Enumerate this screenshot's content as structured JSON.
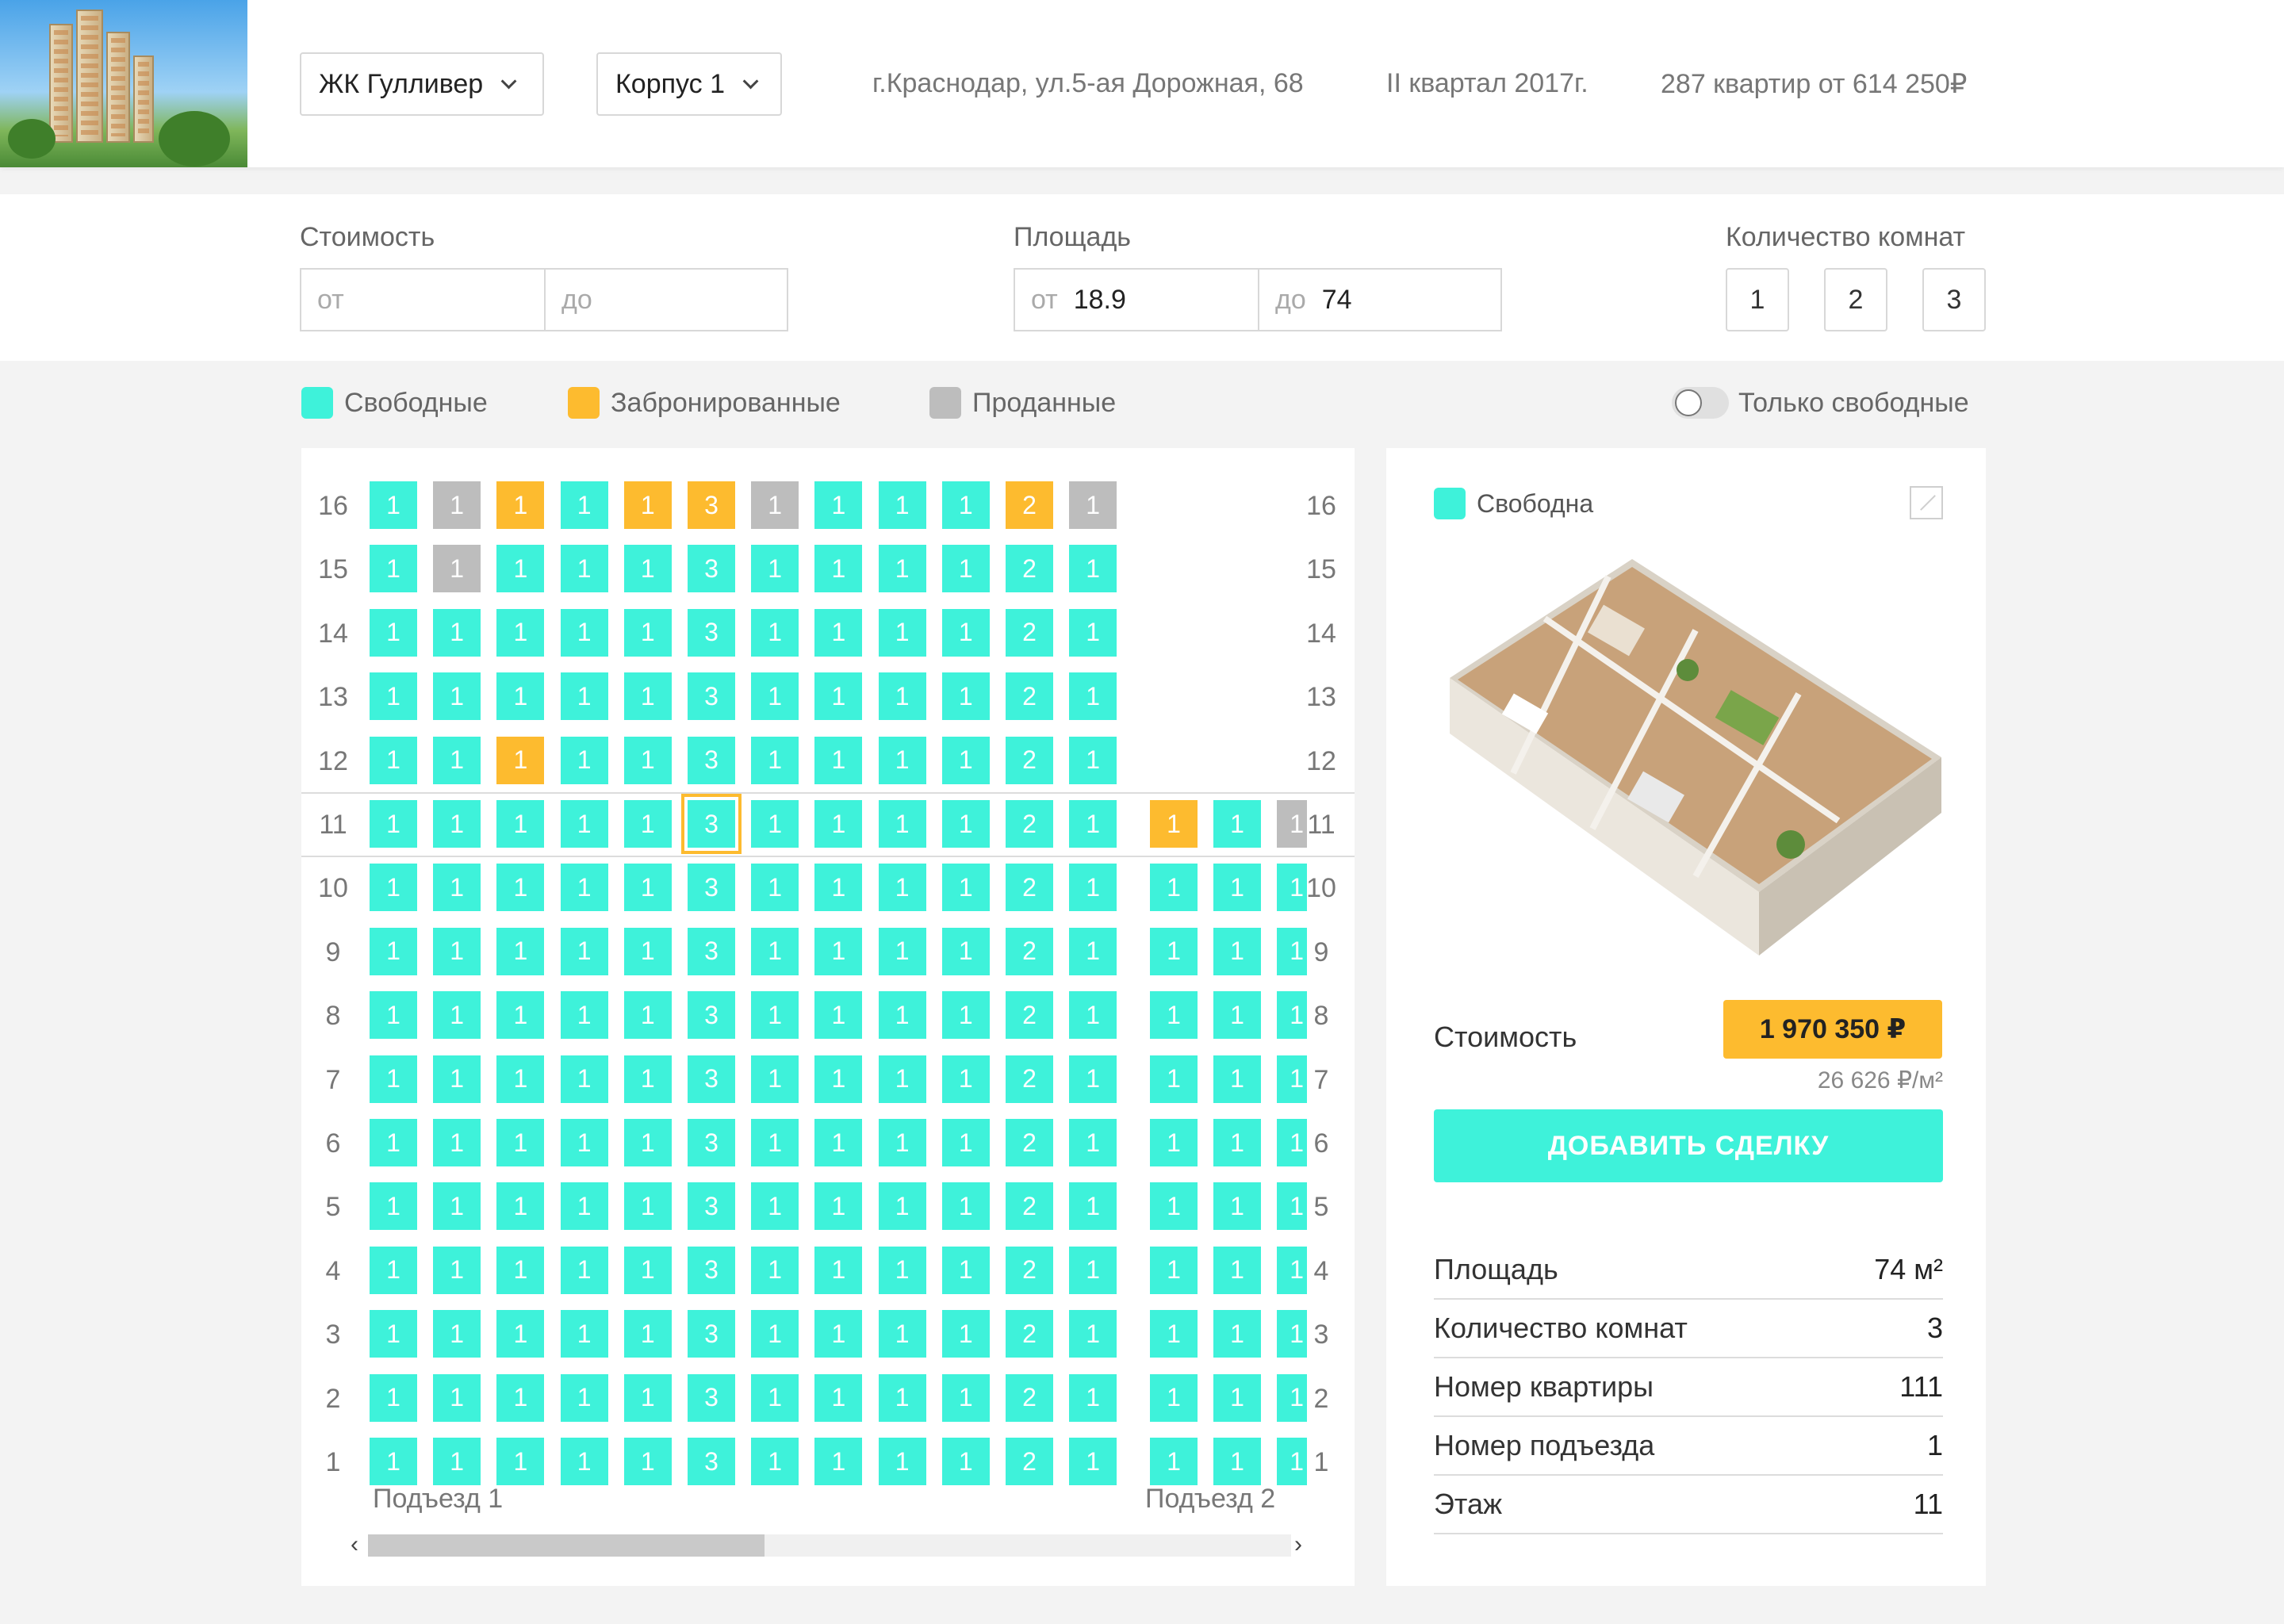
{
  "header": {
    "complex": "ЖК Гулливер",
    "building": "Корпус 1",
    "address": "г.Краснодар, ул.5-ая Дорожная, 68",
    "deadline": "II квартал 2017г.",
    "summary": "287 квартир от 614 250₽"
  },
  "filters": {
    "price_label": "Стоимость",
    "price_from_prefix": "от",
    "price_from": "",
    "price_to_prefix": "до",
    "price_to": "",
    "area_label": "Площадь",
    "area_from_prefix": "от",
    "area_from": "18.9",
    "area_to_prefix": "до",
    "area_to": "74",
    "rooms_label": "Количество комнат",
    "rooms": [
      "1",
      "2",
      "3"
    ]
  },
  "legend": {
    "free": "Свободные",
    "reserved": "Забронированные",
    "sold": "Проданные",
    "only_free": "Только свободные",
    "colors": {
      "free": "#3ef2da",
      "reserved": "#fdbb2f",
      "sold": "#bdbdbd"
    }
  },
  "grid": {
    "floors": [
      16,
      15,
      14,
      13,
      12,
      11,
      10,
      9,
      8,
      7,
      6,
      5,
      4,
      3,
      2,
      1
    ],
    "entrance1_label": "Подъезд 1",
    "entrance2_label": "Подъезд 2",
    "entrance1_rooms": [
      "1",
      "1",
      "1",
      "1",
      "1",
      "3",
      "1",
      "1",
      "1",
      "1",
      "2",
      "1"
    ],
    "entrance2_rooms": [
      "1",
      "1",
      "1"
    ],
    "special": {
      "16": {
        "1": "sold",
        "2": "res",
        "4": "res",
        "5": "res",
        "6": "sold",
        "10": "res",
        "11": "sold"
      },
      "15": {
        "1": "sold"
      },
      "12": {
        "2": "res"
      },
      "11": {
        "e2_0": "res",
        "e2_2": "sold"
      }
    },
    "selected": {
      "floor": 11,
      "index": 5
    },
    "entrance2_start_floor": 11
  },
  "details": {
    "status": "Свободна",
    "cost_label": "Стоимость",
    "price": "1 970 350 ₽",
    "price_per_m2": "26 626 ₽/м²",
    "add_button": "ДОБАВИТЬ СДЕЛКУ",
    "props": [
      {
        "key": "Площадь",
        "value": "74 м²"
      },
      {
        "key": "Количество комнат",
        "value": "3"
      },
      {
        "key": "Номер квартиры",
        "value": "111"
      },
      {
        "key": "Номер подъезда",
        "value": "1"
      },
      {
        "key": "Этаж",
        "value": "11"
      }
    ]
  }
}
